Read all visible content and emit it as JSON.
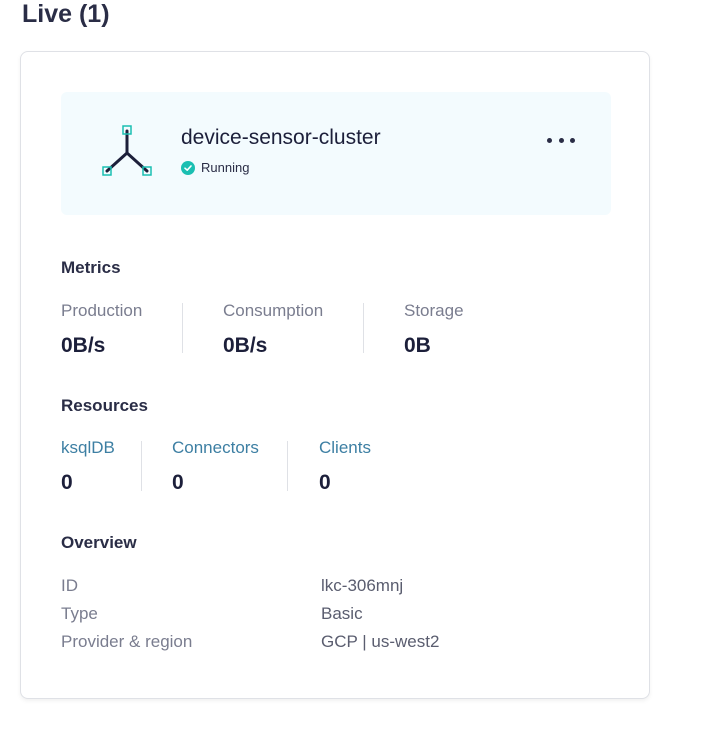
{
  "section": {
    "title": "Live (1)"
  },
  "cluster": {
    "name": "device-sensor-cluster",
    "status": "Running",
    "status_color": "#1bbfb2"
  },
  "metrics": {
    "title": "Metrics",
    "items": [
      {
        "label": "Production",
        "value": "0B/s"
      },
      {
        "label": "Consumption",
        "value": "0B/s"
      },
      {
        "label": "Storage",
        "value": "0B"
      }
    ]
  },
  "resources": {
    "title": "Resources",
    "items": [
      {
        "label": "ksqlDB",
        "value": "0"
      },
      {
        "label": "Connectors",
        "value": "0"
      },
      {
        "label": "Clients",
        "value": "0"
      }
    ]
  },
  "overview": {
    "title": "Overview",
    "rows": [
      {
        "key": "ID",
        "value": "lkc-306mnj"
      },
      {
        "key": "Type",
        "value": "Basic"
      },
      {
        "key": "Provider & region",
        "value": "GCP | us-west2"
      }
    ]
  },
  "icons": {
    "cluster": "cluster-topology-icon",
    "status": "check-circle-icon",
    "more": "more-horizontal-icon"
  },
  "colors": {
    "accent": "#1bbfb2",
    "link": "#3d7fa3",
    "header_bg": "#f3fbfe"
  }
}
